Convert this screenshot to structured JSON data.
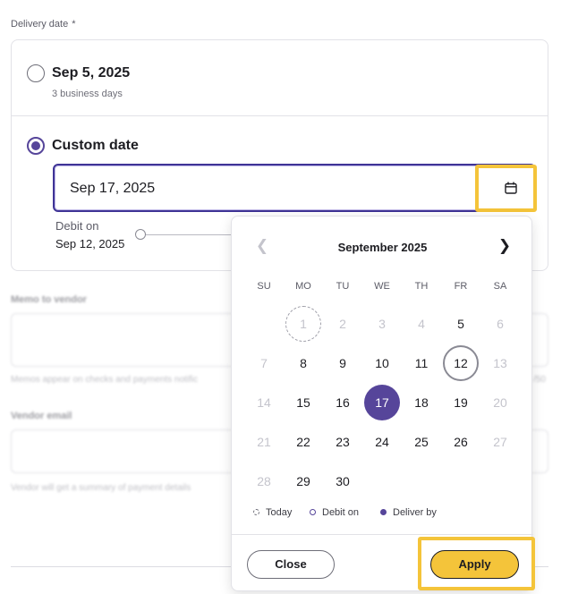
{
  "delivery": {
    "label": "Delivery date",
    "required_mark": "*",
    "options": [
      {
        "title": "Sep 5, 2025",
        "subtitle": "3 business days",
        "selected": false
      },
      {
        "title": "Custom date",
        "selected": true
      }
    ],
    "date_input_value": "Sep 17, 2025",
    "calendar_icon": "calendar-icon",
    "debit_label": "Debit on",
    "debit_date": "Sep 12, 2025"
  },
  "background_form": {
    "memo_label": "Memo to vendor",
    "memo_help": "Memos appear on checks and payments notific",
    "memo_counter_fragment": "/50",
    "email_label": "Vendor email",
    "email_help": "Vendor will get a summary of payment details"
  },
  "calendar": {
    "month": "September 2025",
    "prev_icon": "chevron-left-icon",
    "next_icon": "chevron-right-icon",
    "weekdays": [
      "SU",
      "MO",
      "TU",
      "WE",
      "TH",
      "FR",
      "SA"
    ],
    "weeks": [
      [
        "",
        "1",
        "2",
        "3",
        "4",
        "5",
        "6"
      ],
      [
        "7",
        "8",
        "9",
        "10",
        "11",
        "12",
        "13"
      ],
      [
        "14",
        "15",
        "16",
        "17",
        "18",
        "19",
        "20"
      ],
      [
        "21",
        "22",
        "23",
        "24",
        "25",
        "26",
        "27"
      ],
      [
        "28",
        "29",
        "30",
        "",
        "",
        "",
        ""
      ]
    ],
    "today": "1",
    "debit_on": "12",
    "deliver_by": "17",
    "legend": {
      "today": "Today",
      "debit": "Debit on",
      "deliver": "Deliver by"
    },
    "close_label": "Close",
    "apply_label": "Apply"
  },
  "colors": {
    "accent": "#56459a",
    "highlight": "#f4c43a"
  }
}
